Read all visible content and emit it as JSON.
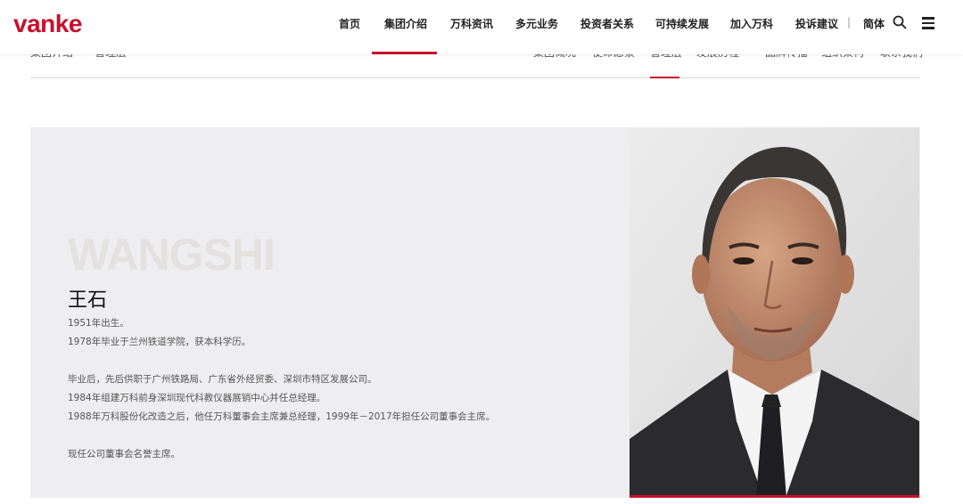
{
  "header": {
    "logo_text": "vanke",
    "nav": [
      "首页",
      "集团介绍",
      "万科资讯",
      "多元业务",
      "投资者关系",
      "可持续发展",
      "加入万科",
      "投诉建议"
    ],
    "nav_active": "集团介绍",
    "separator": "|",
    "language": "简体",
    "search_icon": "search-icon",
    "menu_icon": "hamburger-menu-icon"
  },
  "subnav": {
    "left_items": [
      "集团介绍",
      "管理层"
    ],
    "right_items": [
      "集团概况",
      "使命愿景",
      "管理层",
      "发展历程",
      "品牌传播",
      "组织架构",
      "联系我们"
    ],
    "active": "管理层"
  },
  "profile": {
    "name_en": "WANGSHI",
    "name_cn": "王石",
    "bio": [
      [
        "1951年出生。",
        "1978年毕业于兰州铁道学院，获本科学历。"
      ],
      [
        "毕业后，先后供职于广州铁路局、广东省外经贸委、深圳市特区发展公司。",
        "1984年组建万科前身深圳现代科教仪器展销中心并任总经理。",
        "1988年万科股份化改造之后，他任万科董事会主席兼总经理，1999年－2017年担任公司董事会主席。"
      ],
      [
        "现任公司董事会名誉主席。"
      ]
    ]
  },
  "colors": {
    "brand_red": "#c8102e",
    "card_bg": "#eeeef0",
    "text_dark": "#111111",
    "text_body": "#555555"
  }
}
